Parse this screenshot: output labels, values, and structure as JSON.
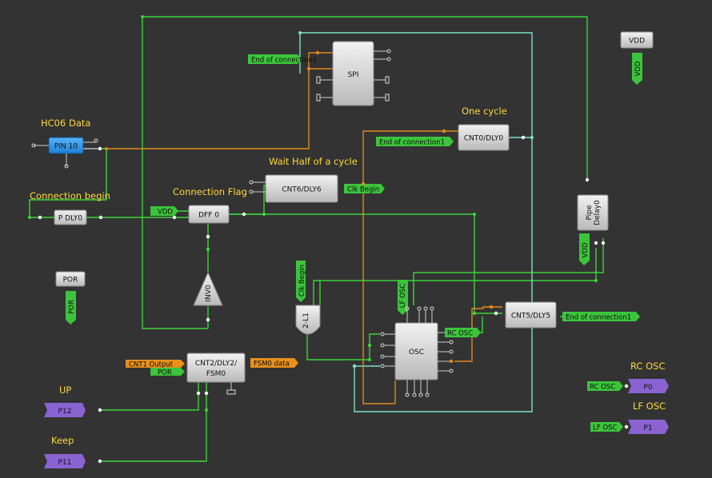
{
  "colors": {
    "background": "#333333",
    "wire_green": "#3ad43a",
    "wire_orange": "#e08a1e",
    "wire_teal": "#7de0c8",
    "block_fill": "#d9d9d9",
    "net_label_green": "#3cc43c",
    "net_label_orange": "#e8901a",
    "pin_blue": "#2b8fe0",
    "pin_purple": "#8a63d2",
    "title_yellow": "#ffd83a"
  },
  "titles": {
    "hc06_data": "HC06 Data",
    "connection_begin": "Connection begin",
    "connection_flag": "Connection Flag",
    "wait_half": "Wait Half of a cycle",
    "one_cycle": "One cycle",
    "up": "UP",
    "keep": "Keep",
    "rc_osc": "RC OSC",
    "lf_osc": "LF OSC"
  },
  "blocks": {
    "pin10": "PIN 10",
    "p_dly0": "P DLY0",
    "dff0": "DFF 0",
    "cnt6": "CNT6/DLY6",
    "spi": "SPI",
    "cnt0": "CNT0/DLY0",
    "inv0": "INV0",
    "lut": "2-L1",
    "osc": "OSC",
    "cnt5": "CNT5/DLY5",
    "cnt2_line1": "CNT2/DLY2/",
    "cnt2_line2": "FSM0",
    "pipe_line1": "Pipe",
    "pipe_line2": "Delay0",
    "por": "POR",
    "vdd_top": "VDD",
    "p12": "P12",
    "p11": "P11",
    "p0": "P0",
    "p1": "P1"
  },
  "net_labels": {
    "end_conn_spi": "End of connection1",
    "end_conn_cnt0": "End of connection1",
    "end_conn_cnt5": "End of connection1",
    "clk_begin_out": "Clk Begin",
    "clk_begin_vert": "Clk Begin",
    "vdd_dff": "VDD",
    "vdd_pipe": "VDD",
    "vdd_top_vert": "VDD",
    "lf_osc_vert": "LF OSC",
    "rc_osc_out": "RC OSC",
    "por_vert": "POR",
    "cnt1_output": "CNT1 Output",
    "por_fsm": "POR",
    "fsm0_data": "FSM0 data",
    "rcosc_p0": "RC OSC",
    "lfosc_p1": "LF OSC"
  }
}
